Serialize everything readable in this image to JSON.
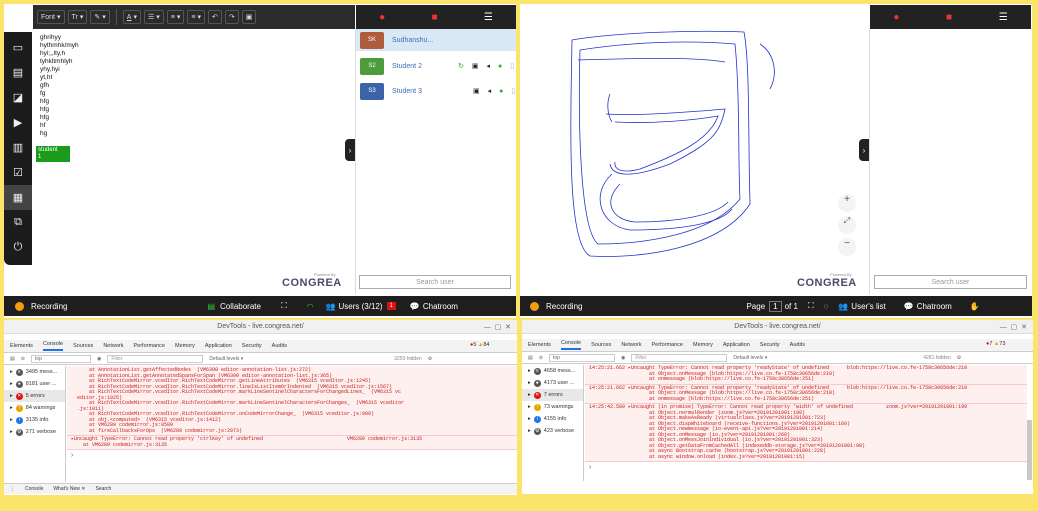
{
  "left_app": {
    "toolbar": {
      "font_label": "Font",
      "size_label": "Tr",
      "color_label": "A",
      "list_label": "☰",
      "indent_label": "≡",
      "align_label": "≡"
    },
    "editor_lines": [
      "ghrihyy",
      "hythmhk/myh",
      "hyi;,,lty,h",
      "tyhkltmhlyh",
      "yhy,hyi",
      "yt,ht",
      "gfh",
      "fg",
      "hfg",
      "hfg",
      "hfg",
      "hf",
      "hg"
    ],
    "cursor_tag": {
      "line1": "student",
      "line2": "1"
    },
    "users": [
      {
        "initials": "SK",
        "name": "Sudhanshu...",
        "color": "#b05c3c"
      },
      {
        "initials": "S2",
        "name": "Student 2",
        "color": "#4a9c3c"
      },
      {
        "initials": "S3",
        "name": "Student 3",
        "color": "#3c62a8"
      }
    ],
    "search_placeholder": "Search user",
    "powered": "Powered By",
    "brand": "CONGREA",
    "bottom": {
      "recording": "Recording",
      "collaborate": "Collaborate",
      "users": "Users (3/12)",
      "users_badge": "1",
      "chatroom": "Chatroom"
    }
  },
  "right_app": {
    "search_placeholder": "Search user",
    "powered": "Powered By",
    "brand": "CONGREA",
    "bottom": {
      "recording": "Recording",
      "page_prefix": "Page",
      "page_num": "1",
      "page_of": "of 1",
      "users": "User's list",
      "chatroom": "Chatroom"
    },
    "zoom": {
      "plus": "+",
      "fit": "⤢",
      "minus": "−"
    }
  },
  "devtools_left": {
    "title": "DevTools - live.congrea.net/",
    "tabs": [
      "Elements",
      "Console",
      "Sources",
      "Network",
      "Performance",
      "Memory",
      "Application",
      "Security",
      "Audits"
    ],
    "errors_count": "5",
    "warnings_count": "84",
    "context": "top",
    "filter_placeholder": "Filter",
    "levels": "Default levels ▾",
    "hidden": "3250 hidden",
    "sidebar": [
      {
        "label": "3495 mess...",
        "type": "all"
      },
      {
        "label": "8181 user ...",
        "type": "user"
      },
      {
        "label": "5 errors",
        "type": "error"
      },
      {
        "label": "84 warnings",
        "type": "warn"
      },
      {
        "label": "3135 info",
        "type": "info"
      },
      {
        "label": "271 verbose",
        "type": "verbose"
      }
    ],
    "log": "    at AnnotationList.getAffectedNodes  (VM6300 editor-annotation-list.js:272)\n    at AnnotationList.getAnnotatedSpansForSpan (VM6300 editor-annotation-list.js:365)\n    at RichTextCodeMirror.vcedItor.RichTextCodeMirror.getLineAttributes  (VM6315 vcedItor.js:1245)\n    at RichTextCodeMirror.vcedItor.RichTextCodeMirror.lineIsListItemOrIndented  (VM6315 vcedItor.js:1567)\n    at RichTextCodeMirror.vcedItor.RichTextCodeMirror.markLineSentinelCharactersForChangedLines_  (VM6315 vc\neditor.js:1025)\n    at RichTextCodeMirror.vcedItor.RichTextCodeMirror.markLineSentinelCharactersForChanges_  (VM6315 vceditor\n.js:1011)\n    at RichTextCodeMirror.vcedItor.RichTextCodeMirror.onCodeMirrorChange_  (VM6315 vceditor.js:909)\n    at obj.<computed>  (VM6315 vceditor.js:1412)\n    at VM6289 codemirror.js:8509\n    at fireCallbacksForOps  (VM6289 codemirror.js:2973)",
    "uncaught": "▸Uncaught TypeError: Cannot read property 'ctrlKey' of undefined                            VM6289 codemirror.js:3135\n    at VM6289 codemirror.js:3135",
    "bottom_tabs": [
      "Console",
      "What's New ✕",
      "Search"
    ]
  },
  "devtools_right": {
    "title": "DevTools - live.congrea.net/",
    "tabs": [
      "Elements",
      "Console",
      "Sources",
      "Network",
      "Performance",
      "Memory",
      "Application",
      "Security",
      "Audits"
    ],
    "errors_count": "7",
    "warnings_count": "73",
    "context": "top",
    "filter_placeholder": "Filter",
    "levels": "Default levels ▾",
    "hidden": "4281 hidden",
    "sidebar": [
      {
        "label": "4658 mess...",
        "type": "all"
      },
      {
        "label": "4173 user ...",
        "type": "user"
      },
      {
        "label": "7 errors",
        "type": "error"
      },
      {
        "label": "73 warnings",
        "type": "warn"
      },
      {
        "label": "4155 info",
        "type": "info"
      },
      {
        "label": "423 verbose",
        "type": "verbose"
      }
    ],
    "errors": [
      "14:25:21.662 ▸Uncaught TypeError: Cannot read property 'readyState' of undefined      blob:https://live.co.fe-1758c30656de:210\n                    at Object.onMessage (blob:https://live.co.fe-1758c30656de:210)\n                    at onmessage (blob:https://live.co.fe-1758c30656de:251)",
      "14:25:21.662 ▸Uncaught TypeError: Cannot read property 'readyState' of undefined      blob:https://live.co.fe-1758c30656de:210\n                    at Object.onMessage (blob:https://live.co.fe-1758c30656de:210)\n                    at onmessage (blob:https://live.co.fe-1758c30656de:251)",
      "14:25:42.580 ▸Uncaught (in promise) TypeError: Cannot read property 'width' of undefined           zoom.js?ver=20191201001:190\n                    at Object.normalRender (zoom.js?ver=20191201001:190)\n                    at Object.makeAsReady (virtualclass.js?ver=20191201001:723)\n                    at Object.dispWhiteboard (receive-functions.js?ver=20191201001:160)\n                    at Object.newmessage (io-event-api.js?ver=20191201001:214)\n                    at Object.onMessage (io.js?ver=20191201001:260)\n                    at Object.onMessJoinIndividual (io.js?ver=20191201001:323)\n                    at Object.getDataFromCachedAll (indexeddb-storage.js?ver=20191201001:98)\n                    at async Bootstrap.cache (bootstrap.js?ver=20191201001:228)\n                    at async window.onload (index.js?ver=20191201001:15)"
    ]
  }
}
